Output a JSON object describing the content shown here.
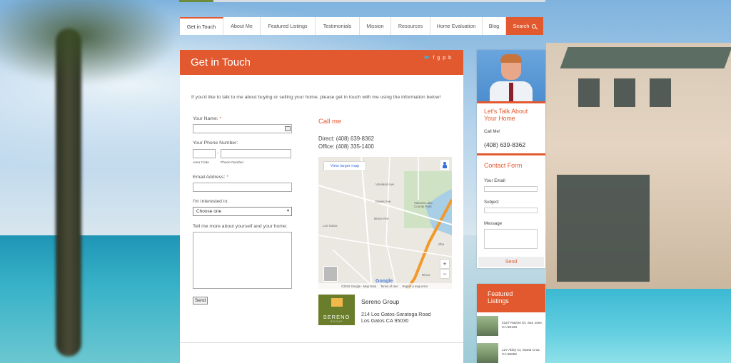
{
  "nav": {
    "items": [
      "Get in Touch",
      "About Me",
      "Featured Listings",
      "Testimonials",
      "Mission",
      "Resources",
      "Home Evaluation",
      "Blog"
    ],
    "search_label": "Search"
  },
  "main": {
    "title": "Get in Touch",
    "social_icons": [
      "twitter-icon",
      "facebook-icon",
      "google-plus-icon",
      "pinterest-icon",
      "blog-icon"
    ],
    "intro": "If you'd like to talk to me about buying or selling your home, please get in touch with me using the information below!",
    "form": {
      "name_label": "Your Name:",
      "phone_label": "Your Phone Number:",
      "area_code_label": "Area Code",
      "phone_number_label": "Phone Number",
      "phone_separator": "-",
      "email_label": "Email Address:",
      "required_mark": "*",
      "interest_label": "I'm Interested in:",
      "interest_selected": "Choose one",
      "message_label": "Tell me more about yourself and your home:",
      "send_label": "Send"
    },
    "call": {
      "heading": "Call me",
      "direct": "Direct: (408) 639-8362",
      "office": "Office: (408) 335-1400"
    },
    "map": {
      "view_larger": "View larger map",
      "attribution": "©2016 Google - Map Data",
      "terms": "Terms of Use",
      "report": "Report a map error",
      "google": "Google",
      "labels": [
        "Vineland Ave",
        "Daves Ave",
        "Bruce Ave",
        "Vasona Lake County Park",
        "Los Gatos",
        "Rinco",
        "Sha"
      ]
    },
    "company": {
      "logo_text": "SERENO",
      "logo_sub": "GROUP",
      "name": "Sereno Group",
      "address1": "214 Los Gatos-Saratoga Road",
      "address2": "Los Gatos CA 95030"
    }
  },
  "sidebar": {
    "talk_heading": "Let's Talk About Your Home",
    "call_me": "Call Me!",
    "phone": "(408) 639-8362",
    "contact_heading": "Contact Form",
    "email_label": "Your Email",
    "subject_label": "Subject",
    "message_label": "Message",
    "send_label": "Send"
  },
  "featured": {
    "heading": "Featured Listings",
    "listings": [
      {
        "address": "2327 Ravine Dr, San Jose, CA 95133"
      },
      {
        "address": "127 Abby Ct, Santa Cruz, CA 95062"
      }
    ]
  },
  "colors": {
    "accent": "#e2592f",
    "logo_green": "#6a7d2b"
  }
}
